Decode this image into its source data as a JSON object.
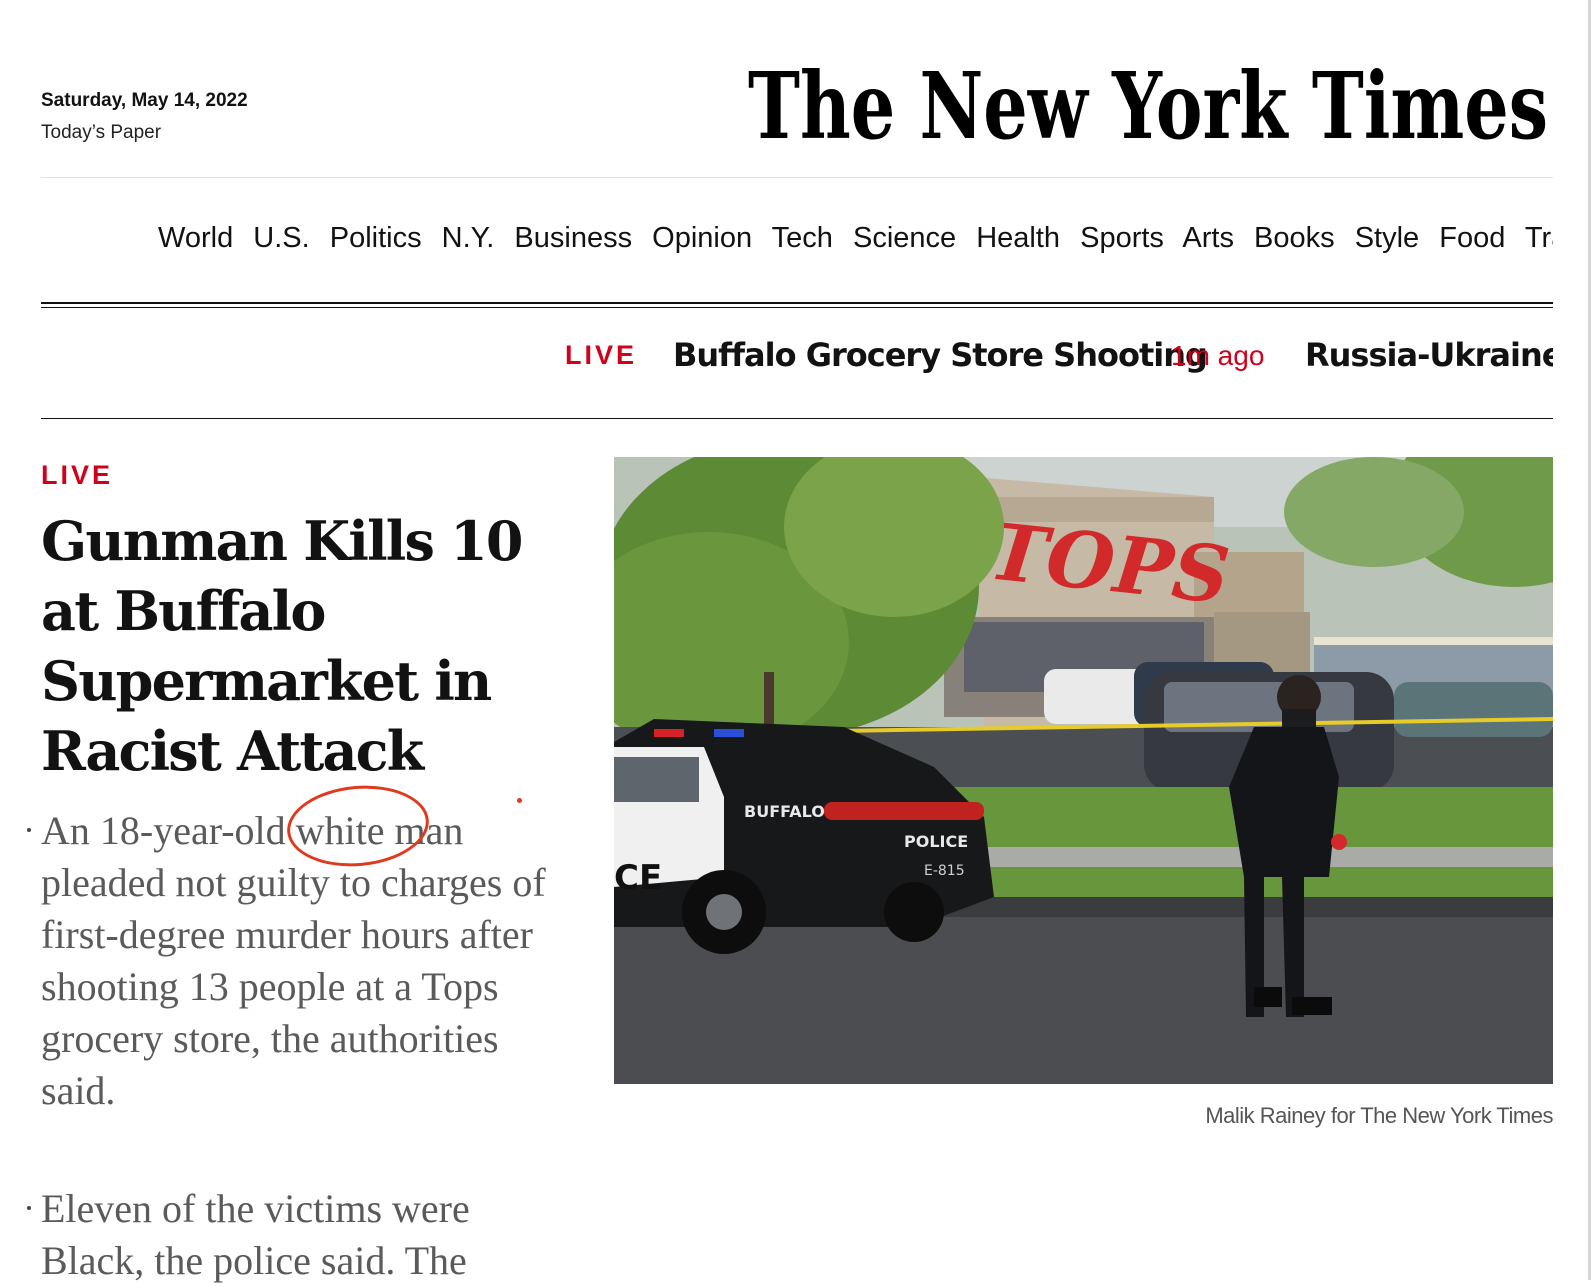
{
  "masthead": {
    "date": "Saturday, May 14, 2022",
    "todays_paper": "Today’s Paper",
    "logo_text": "The New York Times"
  },
  "nav": {
    "items": [
      "World",
      "U.S.",
      "Politics",
      "N.Y.",
      "Business",
      "Opinion",
      "Tech",
      "Science",
      "Health",
      "Sports",
      "Arts",
      "Books",
      "Style",
      "Food",
      "Travel"
    ]
  },
  "ticker": {
    "live_label": "LIVE",
    "story1": "Buffalo Grocery Store Shooting",
    "story1_time": "1m ago",
    "story2": "Russia-Ukraine War"
  },
  "lead": {
    "live_label": "LIVE",
    "headline": "Gunman Kills 10 at Buffalo Supermarket in Racist Attack",
    "summary_1": "An 18-year-old white man pleaded not guilty to charges of first-degree murder hours after shooting 13 people at a Tops grocery store, the authorities said.",
    "summary_2": "Eleven of the victims were Black, the police said. The",
    "photo_credit": "Malik Rainey for The New York Times",
    "photo": {
      "store_sign": "TOPS",
      "car_text_1": "BUFFALO",
      "car_text_2": "POLICE",
      "car_text_3": "E-815",
      "car_text_4": "CE"
    }
  },
  "colors": {
    "live_red": "#d0021b",
    "annotation_red": "#e03a1e",
    "text": "#121212",
    "summary_gray": "#5a5a5a"
  }
}
